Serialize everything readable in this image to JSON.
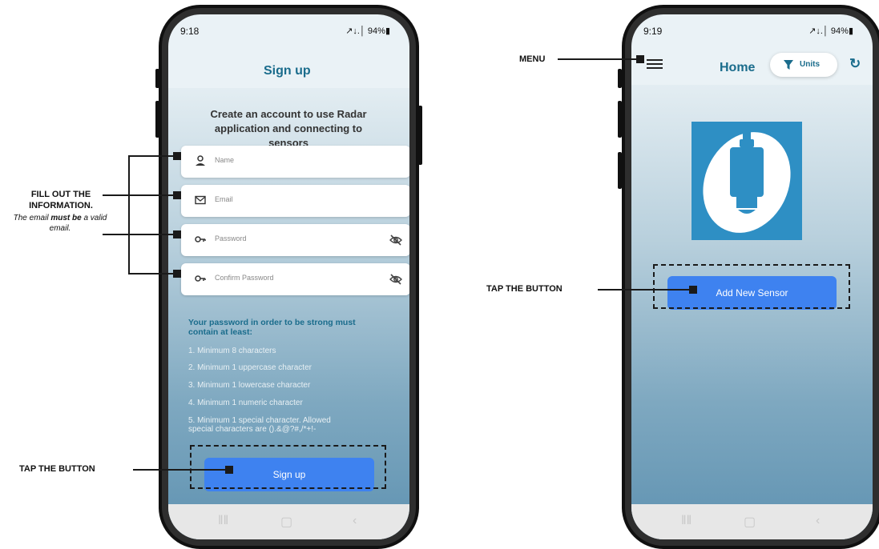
{
  "left_phone": {
    "status_time": "9:18",
    "status_right": "↗↓.│ 94%▮",
    "title": "Sign up",
    "intro": "Create an account to use Radar application and connecting to sensors",
    "fields": [
      {
        "placeholder": "Name",
        "icon": "person-icon"
      },
      {
        "placeholder": "Email",
        "icon": "mail-icon"
      },
      {
        "placeholder": "Password",
        "icon": "key-icon",
        "toggle": "eye-off-icon"
      },
      {
        "placeholder": "Confirm Password",
        "icon": "key-icon",
        "toggle": "eye-off-icon"
      }
    ],
    "rules_title": "Your password in order to be strong must contain at least:",
    "rules": [
      "1. Minimum 8 characters",
      "2. Minimum 1 uppercase character",
      "3. Minimum 1 lowercase character",
      "4. Minimum 1 numeric character",
      "5. Minimum 1 special character. Allowed special characters are ().&@?#,/*+!-"
    ],
    "signup_button": "Sign up"
  },
  "right_phone": {
    "status_time": "9:19",
    "status_right": "↗↓.│ 94%▮",
    "title": "Home",
    "units_button": "Units",
    "add_button": "Add New Sensor"
  },
  "callouts": {
    "fill_title": "FILL OUT THE INFORMATION.",
    "fill_note_prefix": "The email ",
    "fill_note_bold": "must be",
    "fill_note_suffix": " a valid email.",
    "tap_left": "TAP THE BUTTON",
    "menu": "MENU",
    "tap_right": "TAP THE BUTTON"
  },
  "colors": {
    "accent_blue": "#3e82f0",
    "title_teal": "#1a6c8c",
    "logo_bg": "#2e8fc4"
  }
}
